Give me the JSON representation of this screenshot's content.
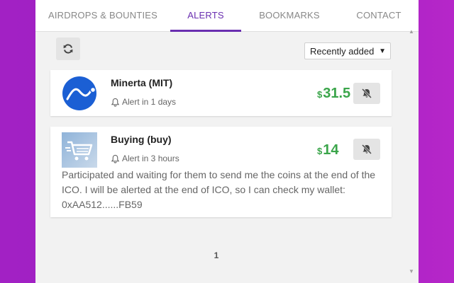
{
  "nav": {
    "tabs": [
      {
        "label": "AIRDROPS & BOUNTIES"
      },
      {
        "label": "ALERTS",
        "active": true
      },
      {
        "label": "BOOKMARKS"
      },
      {
        "label": "CONTACT"
      }
    ]
  },
  "toolbar": {
    "refresh_icon": "refresh-icon",
    "sort_value": "Recently added"
  },
  "alerts": [
    {
      "name": "Minerta (MIT)",
      "alert_text": "Alert in 1 days",
      "currency_symbol": "$",
      "price": "31.5",
      "mute_icon": "bell-slash-icon",
      "note": ""
    },
    {
      "name": "Buying (buy)",
      "alert_text": "Alert in 3 hours",
      "currency_symbol": "$",
      "price": "14",
      "mute_icon": "bell-slash-icon",
      "note": "Participated and waiting for them to send me the coins at the end of the ICO. I will be alerted at the end of ICO, so I can check my wallet: 0xAA512......FB59"
    }
  ],
  "pagination": {
    "current_page": "1"
  },
  "colors": {
    "accent": "#6a2fb0",
    "price": "#3aa54a",
    "background_gradient": "#a221c4"
  }
}
